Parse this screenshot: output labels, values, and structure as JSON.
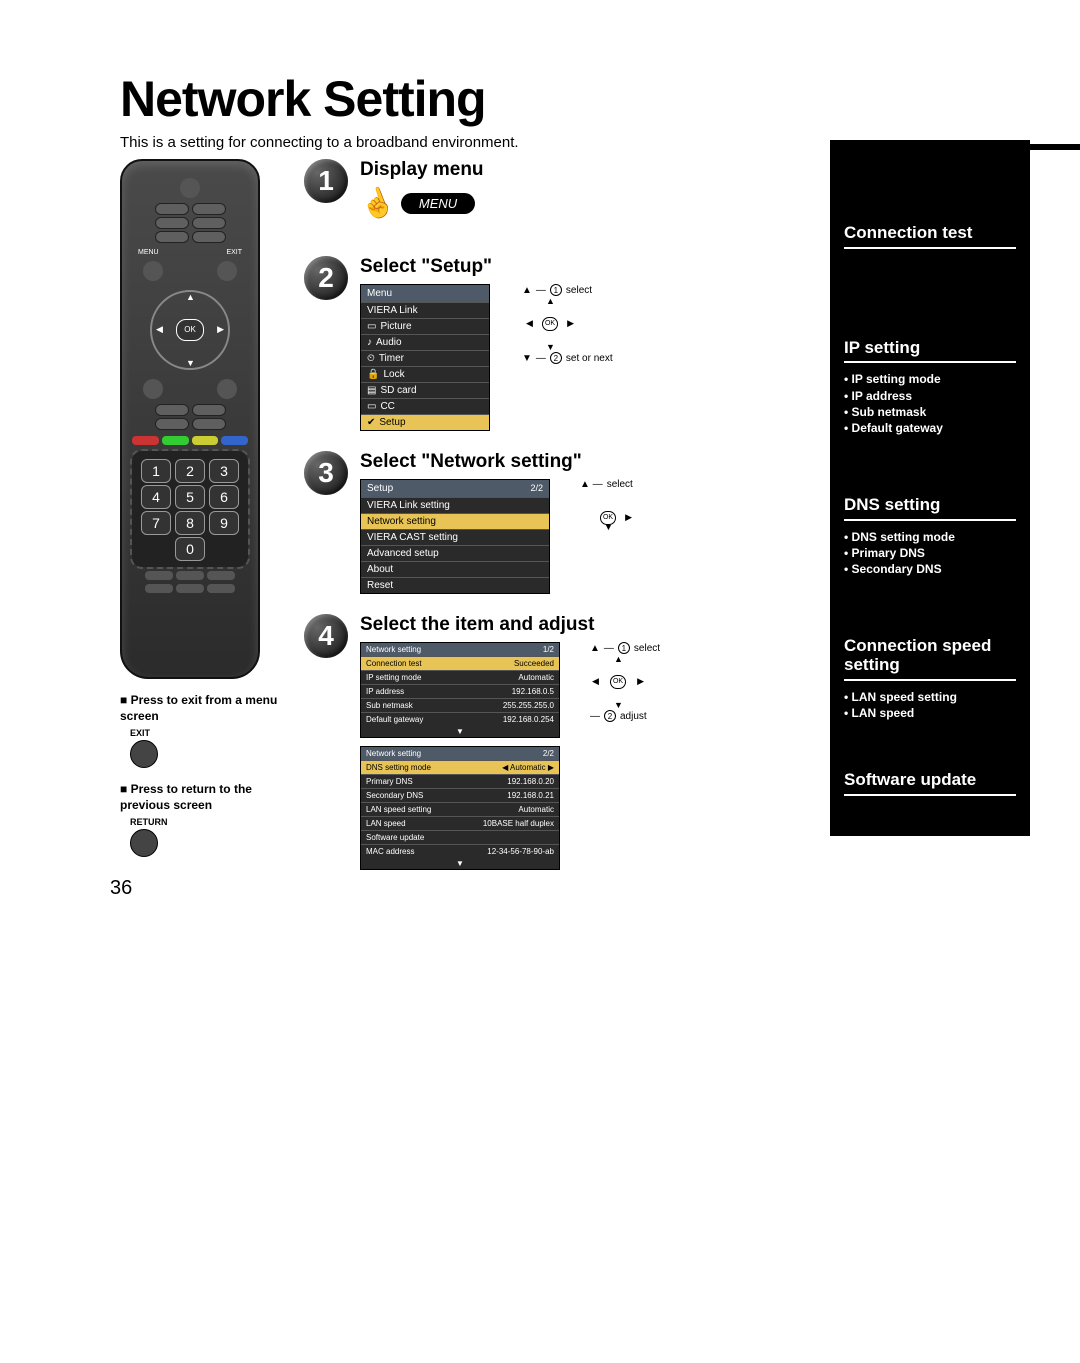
{
  "title": "Network Setting",
  "subtitle": "This is a setting for connecting to a broadband environment.",
  "page_number": "36",
  "remote": {
    "menu_label": "MENU",
    "exit_label": "EXIT",
    "ok_label": "OK",
    "keypad": [
      "1",
      "2",
      "3",
      "4",
      "5",
      "6",
      "7",
      "8",
      "9",
      "0"
    ]
  },
  "notes": {
    "exit": "Press to exit from a menu screen",
    "exit_btn": "EXIT",
    "return": "Press to return to the previous screen",
    "return_btn": "RETURN"
  },
  "steps": {
    "s1": {
      "num": "1",
      "title": "Display menu",
      "menu_btn": "MENU"
    },
    "s2": {
      "num": "2",
      "title": "Select \"Setup\"",
      "menu_header": "Menu",
      "items": [
        "VIERA Link",
        "Picture",
        "Audio",
        "Timer",
        "Lock",
        "SD card",
        "CC",
        "Setup"
      ],
      "annot_select": "select",
      "annot_setnext": "set or next",
      "nav_ok": "OK"
    },
    "s3": {
      "num": "3",
      "title": "Select \"Network setting\"",
      "menu_header": "Setup",
      "page": "2/2",
      "items": [
        "VIERA Link setting",
        "Network setting",
        "VIERA CAST setting",
        "Advanced setup",
        "About",
        "Reset"
      ],
      "annot_select": "select",
      "nav_ok": "OK"
    },
    "s4": {
      "num": "4",
      "title": "Select the item and adjust",
      "table1_header": "Network setting",
      "table1_page": "1/2",
      "table1": [
        {
          "k": "Connection test",
          "v": "Succeeded"
        },
        {
          "k": "IP setting mode",
          "v": "Automatic"
        },
        {
          "k": "IP address",
          "v": "192.168.0.5"
        },
        {
          "k": "Sub netmask",
          "v": "255.255.255.0"
        },
        {
          "k": "Default gateway",
          "v": "192.168.0.254"
        }
      ],
      "table2_header": "Network setting",
      "table2_page": "2/2",
      "table2": [
        {
          "k": "DNS setting mode",
          "v": "Automatic"
        },
        {
          "k": "Primary DNS",
          "v": "192.168.0.20"
        },
        {
          "k": "Secondary DNS",
          "v": "192.168.0.21"
        },
        {
          "k": "LAN speed setting",
          "v": "Automatic"
        },
        {
          "k": "LAN speed",
          "v": "10BASE half duplex"
        },
        {
          "k": "Software update",
          "v": ""
        },
        {
          "k": "MAC address",
          "v": "12-34-56-78-90-ab"
        }
      ],
      "annot_select": "select",
      "annot_adjust": "adjust",
      "nav_ok": "OK"
    }
  },
  "sidebar": {
    "connection_test": "Connection test",
    "ip_setting": {
      "title": "IP setting",
      "items": [
        "IP setting mode",
        "IP address",
        "Sub netmask",
        "Default gateway"
      ]
    },
    "dns_setting": {
      "title": "DNS setting",
      "items": [
        "DNS setting mode",
        "Primary DNS",
        "Secondary DNS"
      ]
    },
    "speed": {
      "title": "Connection speed setting",
      "items": [
        "LAN speed setting",
        "LAN speed"
      ]
    },
    "software": "Software update"
  }
}
